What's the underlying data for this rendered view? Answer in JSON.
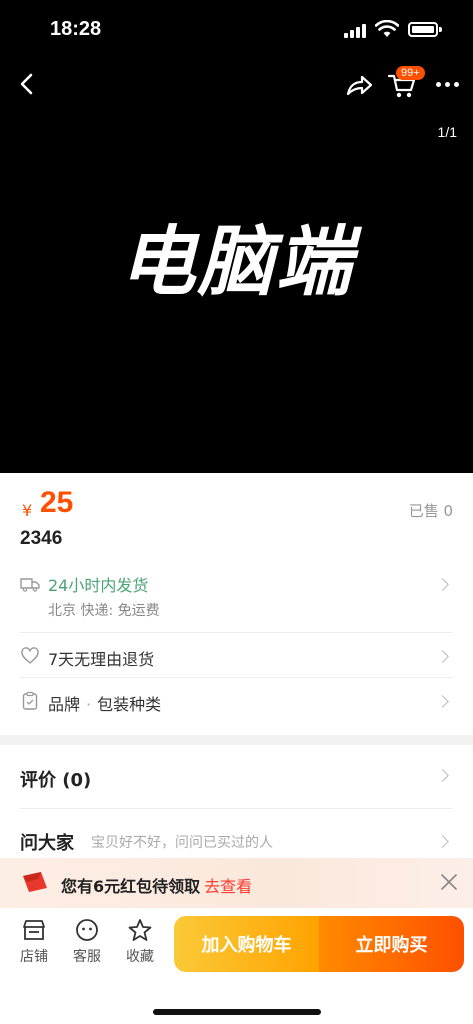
{
  "status_bar": {
    "time": "18:28"
  },
  "header": {
    "cart_badge": "99+",
    "page_indicator": "1/1"
  },
  "hero": {
    "text": "电脑端"
  },
  "product": {
    "currency": "¥",
    "price": "25",
    "sold": "已售 0",
    "title": "2346"
  },
  "shipping": {
    "title": "24小时内发货",
    "subtitle": "北京  快递: 免运费"
  },
  "returns": {
    "label": "7天无理由退货"
  },
  "params": {
    "brand": "品牌",
    "separator": "·",
    "package": "包装种类"
  },
  "reviews": {
    "title": "评价 (0)"
  },
  "qa": {
    "title": "问大家",
    "hint": "宝贝好不好，问问已买过的人"
  },
  "promo": {
    "text": "您有6元红包待领取",
    "link": "去查看"
  },
  "bottom_bar": {
    "store": "店铺",
    "service": "客服",
    "favorite": "收藏",
    "add_to_cart": "加入购物车",
    "buy_now": "立即购买"
  },
  "colors": {
    "accent": "#ff5000",
    "shipping_green": "#4aa476",
    "promo_link": "#ff3b30"
  }
}
